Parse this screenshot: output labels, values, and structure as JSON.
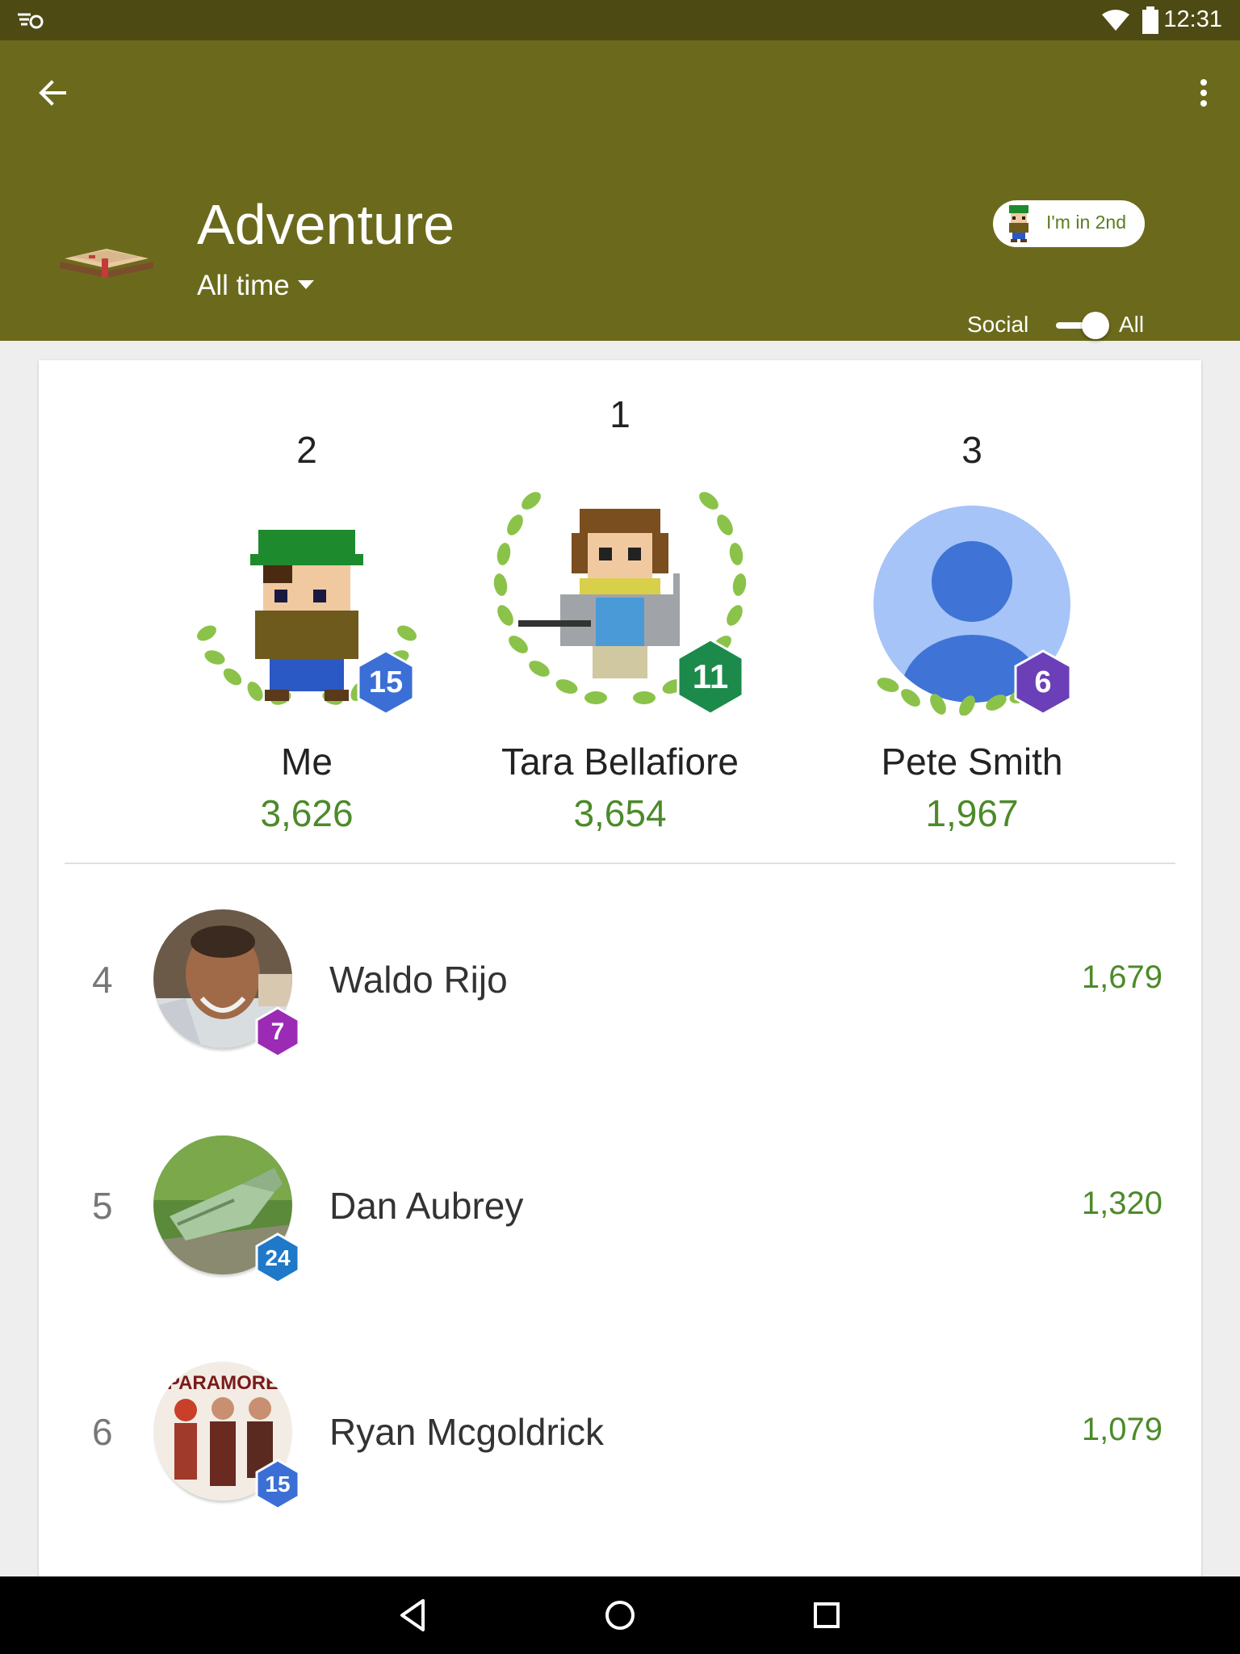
{
  "status_bar": {
    "time": "12:31"
  },
  "header": {
    "title": "Adventure",
    "period": "All time",
    "my_rank_chip": "I'm in 2nd",
    "social_label": "Social",
    "all_label": "All",
    "toggle_state": "All"
  },
  "podium": [
    {
      "rank": "2",
      "name": "Me",
      "score": "3,626",
      "level": "15",
      "level_color": "#3b6fd6"
    },
    {
      "rank": "1",
      "name": "Tara Bellafiore",
      "score": "3,654",
      "level": "11",
      "level_color": "#1b8a4a"
    },
    {
      "rank": "3",
      "name": "Pete Smith",
      "score": "1,967",
      "level": "6",
      "level_color": "#6b3fb8"
    }
  ],
  "list": [
    {
      "rank": "4",
      "name": "Waldo Rijo",
      "score": "1,679",
      "level": "7",
      "level_color": "#9b2bb5"
    },
    {
      "rank": "5",
      "name": "Dan Aubrey",
      "score": "1,320",
      "level": "24",
      "level_color": "#1f78c8"
    },
    {
      "rank": "6",
      "name": "Ryan Mcgoldrick",
      "score": "1,079",
      "level": "15",
      "level_color": "#3b6fd6"
    }
  ],
  "avatar_photo_text": "PARAMORE",
  "colors": {
    "appbar": "#6b6a1c",
    "statusbar": "#4d4a14",
    "score_green": "#4c8a2a"
  }
}
